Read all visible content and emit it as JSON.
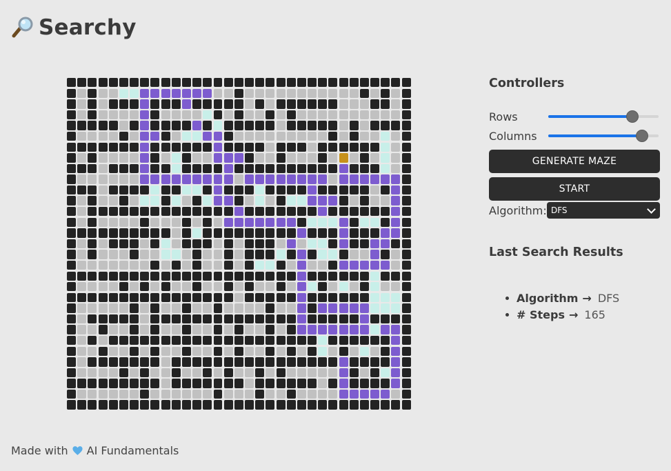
{
  "app": {
    "title": "Searchy",
    "logo_icon": "magnifying-glass-icon"
  },
  "maze": {
    "rows": 31,
    "columns": 33,
    "legend": {
      "w": "wall",
      "o": "open",
      "p": "path",
      "v": "visited",
      "g": "goal"
    },
    "colors": {
      "wall": "#232323",
      "open": "#c1c1c1",
      "path": "#7d5ccf",
      "visited": "#c8efe9",
      "goal": "#c6911b"
    },
    "grid": [
      "wwwwwwwwwwwwwwwwwwwwwwwwwwwwwwwww",
      "wowoovvpppppppoowooooooooooowowow",
      "wowowwwpwwwpwwwwwowowwwwwwooowwow",
      "wowoooopwoooovwowoowowoooooooooow",
      "wwwwwowpwwwwpwvwwwwwowwwwwowowwww",
      "woooowoppwovvppwooooooooowowoovow",
      "wwwwwwwpwwwwwwpwwwwowwwowwwwwwvow",
      "wowoooopwovwoopppwoowooowogowovow",
      "wwwowwwpwwvwwwwpwwwwwwwwwwpwwwvow",
      "woooooopppppppppoppppppppoppppppw",
      "wwwowwwwvwwvvwpwwwvwwwwpwwwwwowpw",
      "wowoowovvwvowvppwovowvvpppwowoopw",
      "wowwwwwwwwwwwwwwpwwwwwwwpwwwwwwpw",
      "wowoooowooowowopppppppwvvvpwvvwpw",
      "wwwwwwwwwwowvwwwwwwwwwpwwwpwwwppw",
      "wowowwwowvowwwowowwwopovvwpwwppww",
      "wowooowoovvowoowowwwvwpwvvwoopwow",
      "wooooooowowowoowowvvwopoowpppppow",
      "wwwwwwwwwwwwwwwwwwwwwwpwwwwwwvwww",
      "woooowowowoowoowowoowopvwovowvoow",
      "wwwwwwwwwwwwwwwwowwwwwpwwwwwwvvvw",
      "wooooowowoowoowoooowoopwpppppvvvw",
      "wowwwwwowwwwwwwwwwwwwwpwwwwwpwwww",
      "woowoowowoowoowowoowowpppppppvppw",
      "wowowwwwwwwwwwwwwwwwwwwwvwwwwwwpw",
      "woowoowowoowoowowoowowowvowovowpw",
      "wowwwwwwwowwwwwwwwwwwwwwwwpwwwwpw",
      "woooowowoowoowowoowowooooopwowvpw",
      "wwwwwwwwwowwwwwwwowwwwwwowpwwwwpw",
      "woooooowoooooowooowoowoooopppppow",
      "wwwwwwwwwwwwwwwwwwwwwwwwwwwwwwwww"
    ]
  },
  "controllers": {
    "title": "Controllers",
    "rows_label": "Rows",
    "rows_value": 0.76,
    "columns_label": "Columns",
    "columns_value": 0.85,
    "generate_label": "GENERATE MAZE",
    "start_label": "START",
    "algorithm_label": "Algorithm:",
    "algorithm_selected": "DFS"
  },
  "results": {
    "title": "Last Search Results",
    "algorithm_label": "Algorithm",
    "arrow": "→",
    "algorithm_value": "DFS",
    "steps_label": "# Steps",
    "steps_value": "165"
  },
  "footer": {
    "made_with": "Made with",
    "heart_icon": "blue-heart-icon",
    "credit": "AI Fundamentals"
  }
}
